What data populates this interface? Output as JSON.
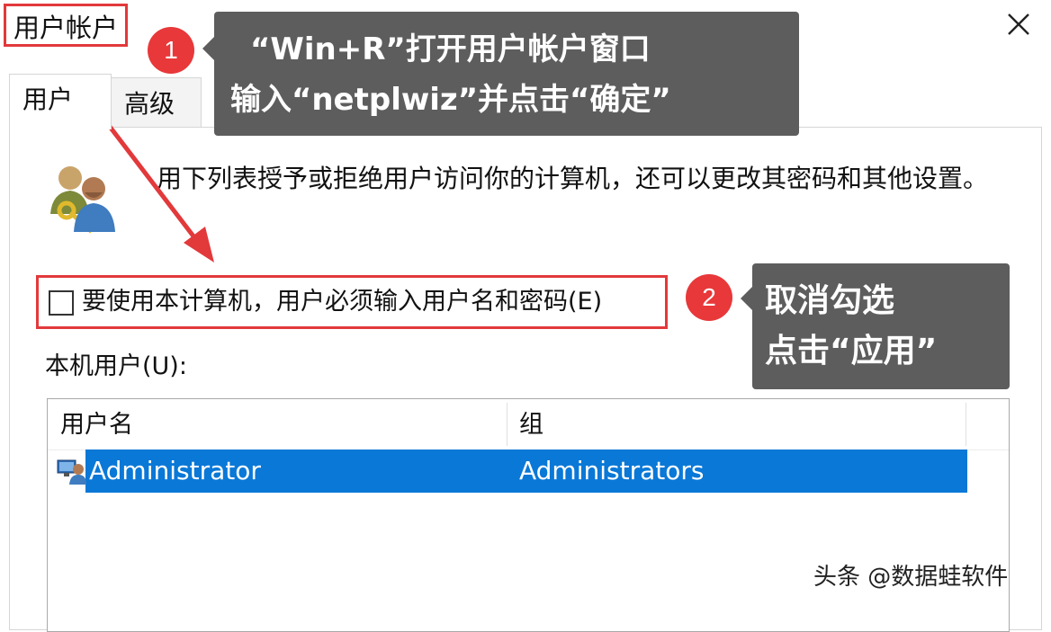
{
  "window": {
    "title": "用户帐户",
    "close_icon": "close-icon"
  },
  "tabs": [
    {
      "label": "用户",
      "selected": true
    },
    {
      "label": "高级",
      "selected": false
    }
  ],
  "users_panel": {
    "icon": "users-key-icon",
    "description": "用下列表授予或拒绝用户访问你的计算机，还可以更改其密码和其他设置。",
    "require_login_checkbox": {
      "label": "要使用本计算机，用户必须输入用户名和密码(E)",
      "checked": false
    },
    "local_users_label": "本机用户(U):",
    "table": {
      "columns": [
        "用户名",
        "组"
      ],
      "rows": [
        {
          "icon": "user-account-icon",
          "name": "Administrator",
          "group": "Administrators",
          "selected": true
        }
      ]
    }
  },
  "annotations": {
    "step1": {
      "badge": "1",
      "lines": [
        "“Win+R”打开用户帐户窗口",
        "输入“netplwiz”并点击“确定”"
      ]
    },
    "step2": {
      "badge": "2",
      "lines": [
        "取消勾选",
        "点击“应用”"
      ]
    },
    "highlight_color": "#e2393b",
    "callout_color": "#5d5d5d",
    "selection_color": "#0a78d7"
  },
  "watermark": "头条 @数据蛙软件"
}
